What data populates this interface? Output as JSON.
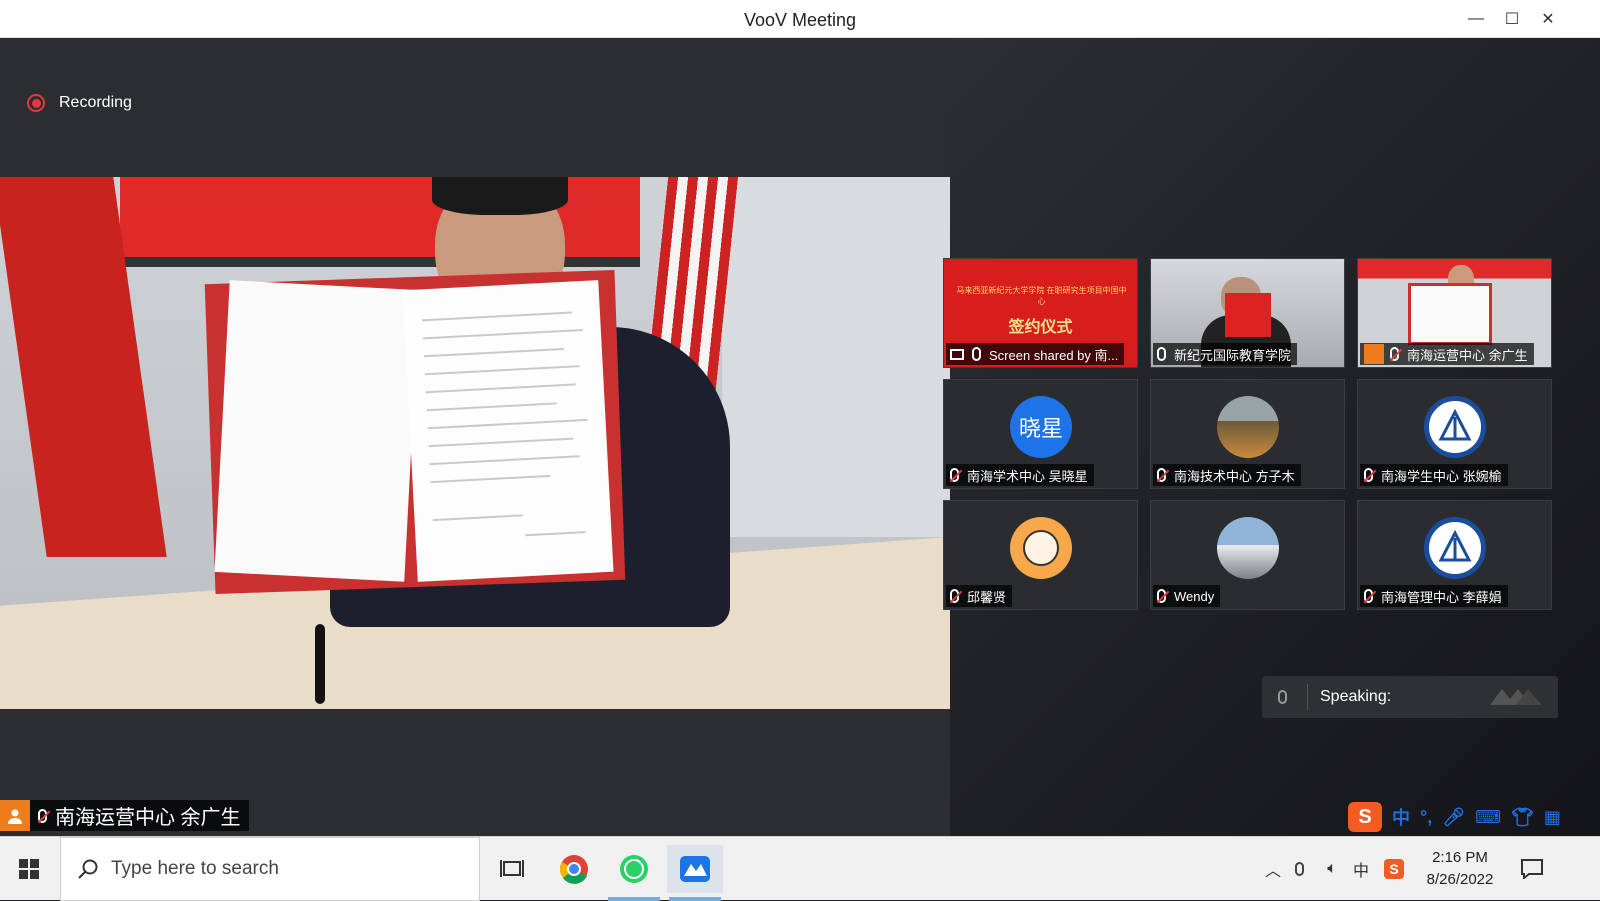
{
  "window": {
    "title": "VooV Meeting",
    "minimize": "—",
    "maximize": "☐",
    "close": "✕"
  },
  "recording": {
    "label": "Recording"
  },
  "main_video": {
    "speaker_name": "南海运营中心 余广生"
  },
  "participants": [
    {
      "name": "Screen shared by 南...",
      "type": "screen-share",
      "muted": false
    },
    {
      "name": "新纪元国际教育学院",
      "type": "video",
      "muted": false
    },
    {
      "name": "南海运营中心 余广生",
      "type": "video",
      "muted": true
    },
    {
      "name": "南海学术中心 吴晓星",
      "type": "avatar-text",
      "avatar_text": "晓星",
      "muted": true
    },
    {
      "name": "南海技术中心 方子木",
      "type": "avatar-photo",
      "muted": true
    },
    {
      "name": "南海学生中心 张婉榆",
      "type": "avatar-logo",
      "muted": true
    },
    {
      "name": "邱馨贤",
      "type": "avatar-cartoon",
      "muted": true
    },
    {
      "name": "Wendy",
      "type": "avatar-photo",
      "muted": true
    },
    {
      "name": "南海管理中心 李薛娟",
      "type": "avatar-logo",
      "muted": true
    }
  ],
  "share_slide": {
    "title_text": "签约仪式",
    "subtitle": "马来西亚新纪元大学学院 在职研究生项目中国中心"
  },
  "speaking": {
    "label": "Speaking:"
  },
  "ime": {
    "mode": "中",
    "punct": "°,"
  },
  "taskbar": {
    "search_placeholder": "Type here to search",
    "tray_input": "中",
    "time": "2:16 PM",
    "date": "8/26/2022"
  },
  "colors": {
    "accent_blue": "#1f6fe0",
    "recording_red": "#e03a3a",
    "avatar_orange": "#f07d1c"
  }
}
